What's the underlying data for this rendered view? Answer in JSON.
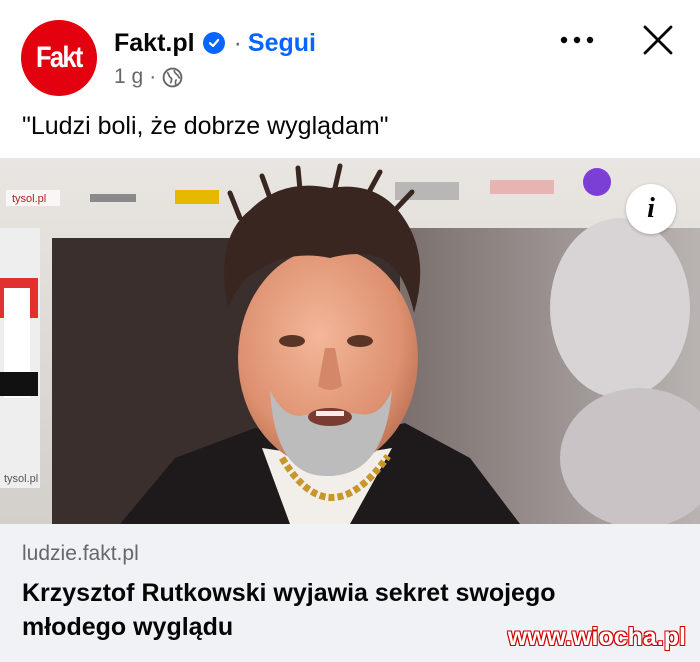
{
  "header": {
    "avatar_text": "Fakt",
    "page_name": "Fakt.pl",
    "separator": "·",
    "follow_label": "Segui",
    "timestamp": "1 g",
    "meta_separator": "·",
    "verified_icon": "verified-badge-icon",
    "privacy_icon": "globe-icon",
    "more_icon": "more-options-icon",
    "close_icon": "close-icon"
  },
  "caption": "\"Ludzi boli, że dobrze wyglądam\"",
  "media": {
    "info_label": "i"
  },
  "link": {
    "domain": "ludzie.fakt.pl",
    "headline": "Krzysztof Rutkowski wyjawia sekret swojego młodego wyglądu"
  },
  "watermark": "www.wiocha.pl",
  "colors": {
    "brand_red": "#e3000f",
    "facebook_blue": "#0866ff",
    "link_bg": "#f0f2f5",
    "secondary_text": "#65676b"
  }
}
